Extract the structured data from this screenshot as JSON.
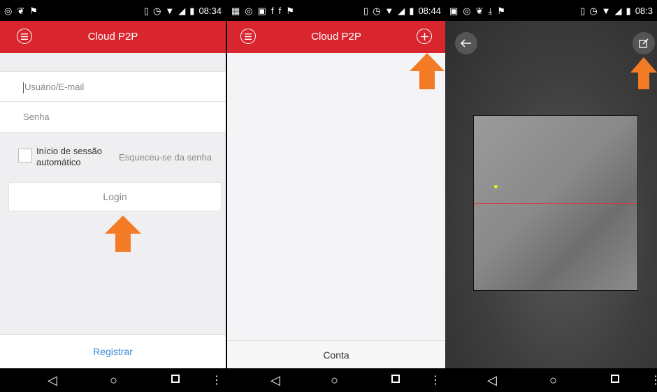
{
  "panel1": {
    "status": {
      "time": "08:34"
    },
    "header": {
      "title": "Cloud P2P",
      "menu_icon": "menu-icon"
    },
    "form": {
      "username_placeholder": "Usuário/E-mail",
      "password_placeholder": "Senha",
      "autologin_label_line1": "Início de sessão",
      "autologin_label_line2": "automático",
      "forgot_password": "Esqueceu-se da senha",
      "login_button": "Login"
    },
    "footer": {
      "register_label": "Registrar"
    }
  },
  "panel2": {
    "status": {
      "time": "08:44"
    },
    "header": {
      "title": "Cloud P2P",
      "menu_icon": "menu-icon",
      "add_icon": "add-icon"
    },
    "footer": {
      "account_tab": "Conta"
    }
  },
  "panel3": {
    "status": {
      "time": "08:3"
    },
    "header": {
      "back_icon": "back-arrow-icon",
      "edit_icon": "edit-icon"
    }
  },
  "colors": {
    "brand_red": "#d9252e",
    "highlight_arrow": "#f47b25",
    "link_blue": "#3b8ed8"
  }
}
